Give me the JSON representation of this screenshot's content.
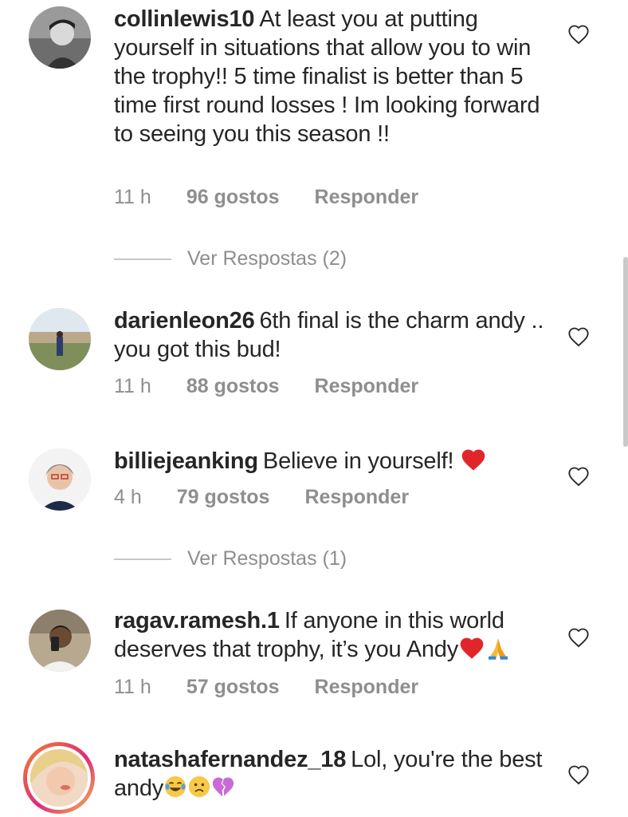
{
  "comments": [
    {
      "username": "collinlewis10",
      "text": "At least you at putting yourself in situations that allow you to win the trophy!! 5 time finalist is better than 5 time first round losses ! Im looking forward to seeing you this season !!",
      "time": "11 h",
      "likes": "96 gostos",
      "reply": "Responder",
      "view_replies": "Ver Respostas (2)"
    },
    {
      "username": "darienleon26",
      "text": "6th final is the charm andy .. you got this bud!",
      "time": "11 h",
      "likes": "88 gostos",
      "reply": "Responder"
    },
    {
      "username": "billiejeanking",
      "text": "Believe in yourself!",
      "emoji_after": "red-heart",
      "time": "4 h",
      "likes": "79 gostos",
      "reply": "Responder",
      "view_replies": "Ver Respostas (1)"
    },
    {
      "username": "ragav.ramesh.1",
      "text": "If anyone in this world deserves that trophy, it’s you Andy",
      "emoji_after": "red-heart, folded-hands",
      "time": "11 h",
      "likes": "57 gostos",
      "reply": "Responder"
    },
    {
      "username": "natashafernandez_18",
      "text": "Lol, you're the best andy",
      "emoji_after": "tears-of-joy, worried-face, broken-heart"
    }
  ],
  "colors": {
    "text": "#262626",
    "muted": "#8e8e8e",
    "heart_red": "#e0262b"
  }
}
